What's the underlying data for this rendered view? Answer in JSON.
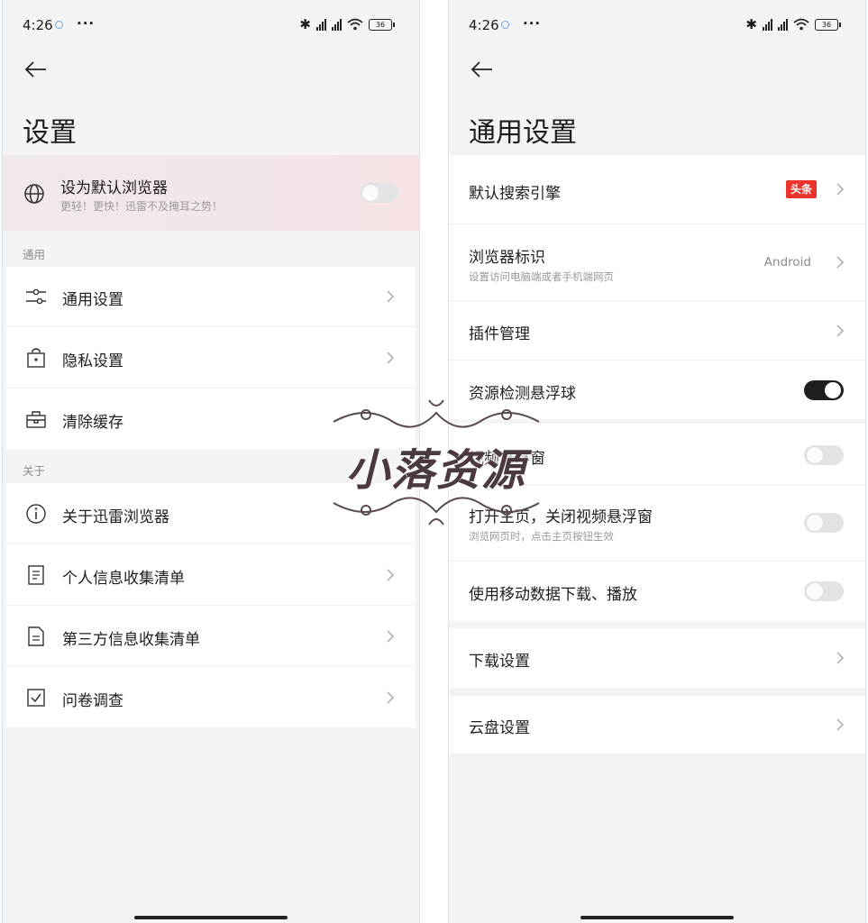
{
  "status_bar": {
    "time": "4:26",
    "more": "···",
    "battery": "36"
  },
  "left": {
    "title": "设置",
    "promo": {
      "label": "设为默认浏览器",
      "sub": "更轻！更快！迅雷不及掩耳之势！",
      "toggle_on": false
    },
    "section_general": "通用",
    "general_items": [
      {
        "label": "通用设置",
        "icon": "sliders-icon"
      },
      {
        "label": "隐私设置",
        "icon": "lock-bag-icon"
      },
      {
        "label": "清除缓存",
        "icon": "toolbox-icon"
      }
    ],
    "section_about": "关于",
    "about_items": [
      {
        "label": "关于迅雷浏览器",
        "icon": "info-icon"
      },
      {
        "label": "个人信息收集清单",
        "icon": "list-doc-icon"
      },
      {
        "label": "第三方信息收集清单",
        "icon": "doc-icon"
      },
      {
        "label": "问卷调查",
        "icon": "checkbox-icon"
      }
    ]
  },
  "right": {
    "title": "通用设置",
    "search_engine": {
      "label": "默认搜索引擎",
      "badge": "头条",
      "badge_color": "#e9332b"
    },
    "ua": {
      "label": "浏览器标识",
      "sub": "设置访问电脑端或者手机端网页",
      "value": "Android"
    },
    "plugins": {
      "label": "插件管理"
    },
    "resource_ball": {
      "label": "资源检测悬浮球",
      "toggle_on": true
    },
    "video_float": {
      "label": "视频悬浮窗",
      "toggle_on": false
    },
    "open_home": {
      "label": "打开主页，关闭视频悬浮窗",
      "sub": "浏览网页时，点击主页按钮生效",
      "toggle_on": false
    },
    "mobile_data": {
      "label": "使用移动数据下载、播放",
      "toggle_on": false
    },
    "download": {
      "label": "下载设置"
    },
    "cloud": {
      "label": "云盘设置"
    }
  },
  "watermark": {
    "text": "小落资源"
  }
}
